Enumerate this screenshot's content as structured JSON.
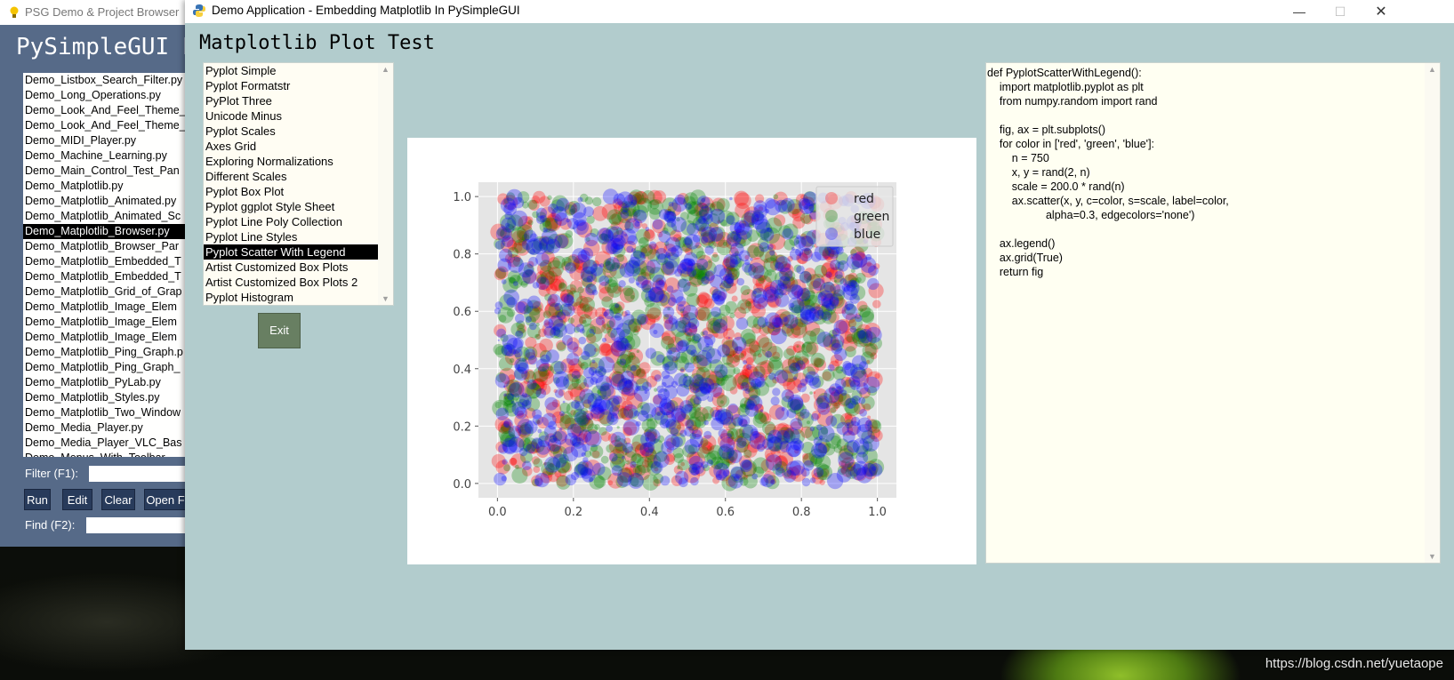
{
  "background_window": {
    "title": "PSG Demo & Project Browser",
    "heading": "PySimpleGUI De",
    "files": [
      "Demo_Listbox_Search_Filter.py",
      "Demo_Long_Operations.py",
      "Demo_Look_And_Feel_Theme_",
      "Demo_Look_And_Feel_Theme_",
      "Demo_MIDI_Player.py",
      "Demo_Machine_Learning.py",
      "Demo_Main_Control_Test_Pan",
      "Demo_Matplotlib.py",
      "Demo_Matplotlib_Animated.py",
      "Demo_Matplotlib_Animated_Sc",
      "Demo_Matplotlib_Browser.py",
      "Demo_Matplotlib_Browser_Par",
      "Demo_Matplotlib_Embedded_T",
      "Demo_Matplotlib_Embedded_T",
      "Demo_Matplotlib_Grid_of_Grap",
      "Demo_Matplotlib_Image_Elem",
      "Demo_Matplotlib_Image_Elem",
      "Demo_Matplotlib_Image_Elem",
      "Demo_Matplotlib_Ping_Graph.p",
      "Demo_Matplotlib_Ping_Graph_",
      "Demo_Matplotlib_PyLab.py",
      "Demo_Matplotlib_Styles.py",
      "Demo_Matplotlib_Two_Window",
      "Demo_Media_Player.py",
      "Demo_Media_Player_VLC_Bas",
      "Demo_Menus_With_Toolbar"
    ],
    "selected_file_index": 10,
    "filter_label": "Filter (F1):",
    "find_label": "Find (F2):",
    "buttons": {
      "run": "Run",
      "edit": "Edit",
      "clear": "Clear",
      "open": "Open F"
    }
  },
  "window": {
    "title": "Demo Application - Embedding Matplotlib In PySimpleGUI",
    "minimize_glyph": "—",
    "maximize_glyph": "☐",
    "close_glyph": "✕"
  },
  "page_title": "Matplotlib Plot Test",
  "plot_list": {
    "items": [
      "Pyplot Simple",
      "Pyplot Formatstr",
      "PyPlot Three",
      "Unicode Minus",
      "Pyplot Scales",
      "Axes Grid",
      "Exploring Normalizations",
      "Different Scales",
      "Pyplot Box Plot",
      "Pyplot ggplot Style Sheet",
      "Pyplot Line Poly Collection",
      "Pyplot Line Styles",
      "Pyplot Scatter With Legend",
      "Artist Customized Box Plots",
      "Artist Customized Box Plots 2",
      "Pyplot Histogram"
    ],
    "selected_index": 12
  },
  "exit_label": "Exit",
  "code": "def PyplotScatterWithLegend():\n    import matplotlib.pyplot as plt\n    from numpy.random import rand\n\n    fig, ax = plt.subplots()\n    for color in ['red', 'green', 'blue']:\n        n = 750\n        x, y = rand(2, n)\n        scale = 200.0 * rand(n)\n        ax.scatter(x, y, c=color, s=scale, label=color,\n                   alpha=0.3, edgecolors='none')\n\n    ax.legend()\n    ax.grid(True)\n    return fig",
  "watermark": "https://blog.csdn.net/yuetaope",
  "chart_data": {
    "type": "scatter",
    "xlim": [
      -0.05,
      1.05
    ],
    "ylim": [
      -0.05,
      1.05
    ],
    "x_ticks": [
      "0.0",
      "0.2",
      "0.4",
      "0.6",
      "0.8",
      "1.0"
    ],
    "y_ticks": [
      "0.0",
      "0.2",
      "0.4",
      "0.6",
      "0.8",
      "1.0"
    ],
    "grid": true,
    "legend_position": "upper-right",
    "points_per_series": 750,
    "alpha": 0.3,
    "series": [
      {
        "name": "red",
        "color": "#ff0000"
      },
      {
        "name": "green",
        "color": "#008000"
      },
      {
        "name": "blue",
        "color": "#0000ff"
      }
    ]
  }
}
